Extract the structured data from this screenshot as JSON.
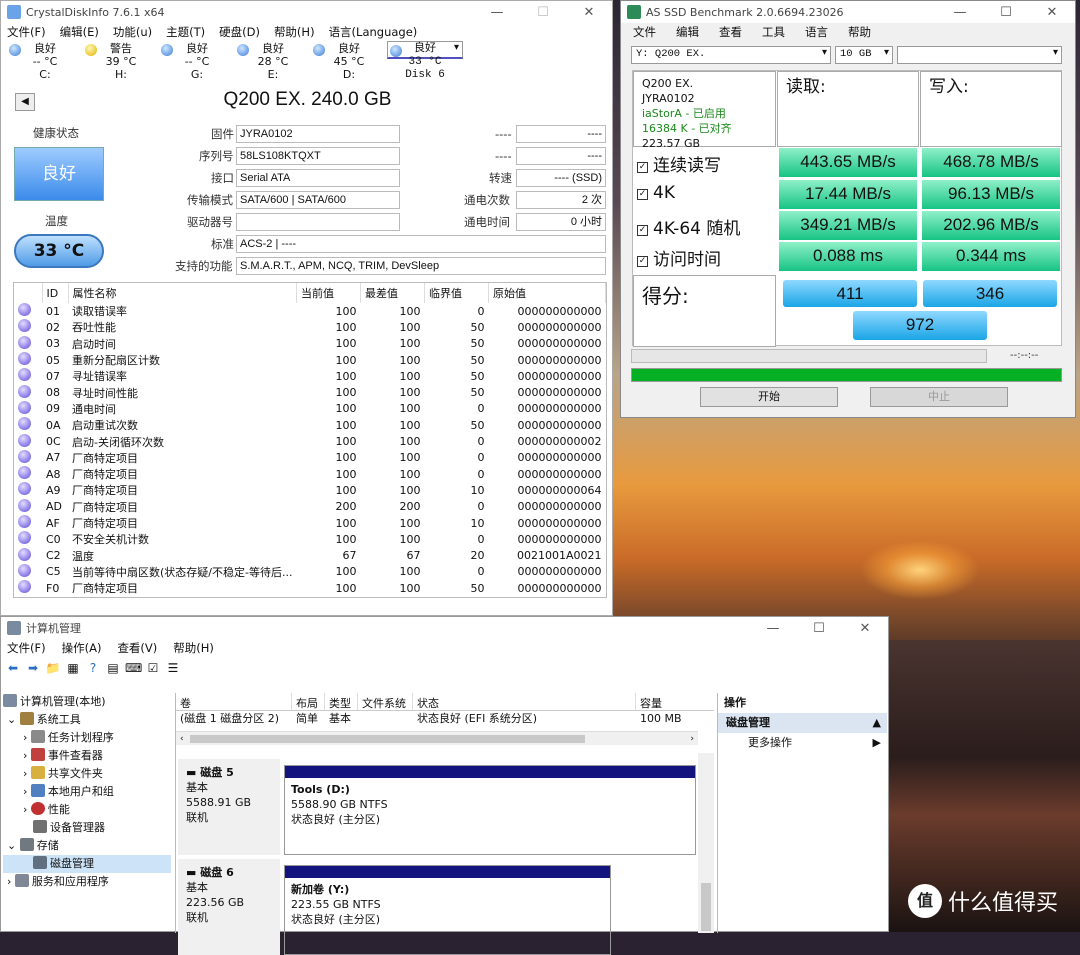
{
  "cdi": {
    "title": "CrystalDiskInfo 7.6.1 x64",
    "menu": [
      "文件(F)",
      "编辑(E)",
      "功能(u)",
      "主题(T)",
      "硬盘(D)",
      "帮助(H)",
      "语言(Language)"
    ],
    "drives": [
      {
        "status": "良好",
        "temp": "-- °C",
        "letter": "C:"
      },
      {
        "status": "警告",
        "temp": "39 °C",
        "letter": "H:"
      },
      {
        "status": "良好",
        "temp": "-- °C",
        "letter": "G:"
      },
      {
        "status": "良好",
        "temp": "28 °C",
        "letter": "E:"
      },
      {
        "status": "良好",
        "temp": "45 °C",
        "letter": "D:"
      },
      {
        "status": "良好",
        "temp": "33 °C",
        "letter": "Disk 6"
      }
    ],
    "model": "Q200 EX. 240.0 GB",
    "health_label": "健康状态",
    "health": "良好",
    "temp_label": "温度",
    "temp": "33 °C",
    "firmware_l": "固件",
    "firmware": "JYRA0102",
    "serial_l": "序列号",
    "serial": "58LS108KTQXT",
    "iface_l": "接口",
    "iface": "Serial ATA",
    "mode_l": "传输模式",
    "mode": "SATA/600 | SATA/600",
    "letter_l": "驱动器号",
    "letter": "",
    "std_l": "标准",
    "std": "ACS-2 | ----",
    "feat_l": "支持的功能",
    "feat": "S.M.A.R.T., APM, NCQ, TRIM, DevSleep",
    "r1a": "----",
    "r1b": "----",
    "r2a": "----",
    "r2b": "----",
    "rot_l": "转速",
    "rot": "---- (SSD)",
    "pc_l": "通电次数",
    "pc": "2 次",
    "ph_l": "通电时间",
    "ph": "0 小时",
    "smart_head": [
      "ID",
      "属性名称",
      "当前值",
      "最差值",
      "临界值",
      "原始值"
    ],
    "smart": [
      [
        "01",
        "读取错误率",
        "100",
        "100",
        "0",
        "000000000000"
      ],
      [
        "02",
        "吞吐性能",
        "100",
        "100",
        "50",
        "000000000000"
      ],
      [
        "03",
        "启动时间",
        "100",
        "100",
        "50",
        "000000000000"
      ],
      [
        "05",
        "重新分配扇区计数",
        "100",
        "100",
        "50",
        "000000000000"
      ],
      [
        "07",
        "寻址错误率",
        "100",
        "100",
        "50",
        "000000000000"
      ],
      [
        "08",
        "寻址时间性能",
        "100",
        "100",
        "50",
        "000000000000"
      ],
      [
        "09",
        "通电时间",
        "100",
        "100",
        "0",
        "000000000000"
      ],
      [
        "0A",
        "启动重试次数",
        "100",
        "100",
        "50",
        "000000000000"
      ],
      [
        "0C",
        "启动-关闭循环次数",
        "100",
        "100",
        "0",
        "000000000002"
      ],
      [
        "A7",
        "厂商特定项目",
        "100",
        "100",
        "0",
        "000000000000"
      ],
      [
        "A8",
        "厂商特定项目",
        "100",
        "100",
        "0",
        "000000000000"
      ],
      [
        "A9",
        "厂商特定项目",
        "100",
        "100",
        "10",
        "000000000064"
      ],
      [
        "AD",
        "厂商特定项目",
        "200",
        "200",
        "0",
        "000000000000"
      ],
      [
        "AF",
        "厂商特定项目",
        "100",
        "100",
        "10",
        "000000000000"
      ],
      [
        "C0",
        "不安全关机计数",
        "100",
        "100",
        "0",
        "000000000000"
      ],
      [
        "C2",
        "温度",
        "67",
        "67",
        "20",
        "0021001A0021"
      ],
      [
        "C5",
        "当前等待中扇区数(状态存疑/不稳定-等待后...",
        "100",
        "100",
        "0",
        "000000000000"
      ],
      [
        "F0",
        "厂商特定项目",
        "100",
        "100",
        "50",
        "000000000000"
      ]
    ]
  },
  "ssd": {
    "title": "AS SSD Benchmark 2.0.6694.23026",
    "menu": [
      "文件",
      "编辑",
      "查看",
      "工具",
      "语言",
      "帮助"
    ],
    "drive": "Y: Q200 EX.",
    "size": "10 GB",
    "info": [
      "Q200 EX.",
      "JYRA0102",
      "iaStorA - 已启用",
      "16384 K - 已对齐",
      "223.57 GB"
    ],
    "read_h": "读取:",
    "write_h": "写入:",
    "rows": [
      {
        "label": "连续读写",
        "read": "443.65 MB/s",
        "write": "468.78 MB/s"
      },
      {
        "label": "4K",
        "read": "17.44 MB/s",
        "write": "96.13 MB/s"
      },
      {
        "label": "4K-64 随机",
        "read": "349.21 MB/s",
        "write": "202.96 MB/s"
      },
      {
        "label": "访问时间",
        "read": "0.088 ms",
        "write": "0.344 ms"
      }
    ],
    "score_l": "得分:",
    "score_r": "411",
    "score_w": "346",
    "score_t": "972",
    "time": "--:--:--",
    "progress": 1.0,
    "start": "开始",
    "stop": "中止"
  },
  "cm": {
    "title": "计算机管理",
    "menu": [
      "文件(F)",
      "操作(A)",
      "查看(V)",
      "帮助(H)"
    ],
    "tree": [
      "计算机管理(本地)",
      "系统工具",
      "任务计划程序",
      "事件查看器",
      "共享文件夹",
      "本地用户和组",
      "性能",
      "设备管理器",
      "存储",
      "磁盘管理",
      "服务和应用程序"
    ],
    "cols": [
      "卷",
      "布局",
      "类型",
      "文件系统",
      "状态",
      "容量"
    ],
    "row": [
      "(磁盘 1 磁盘分区 2)",
      "简单",
      "基本",
      "",
      "状态良好 (EFI 系统分区)",
      "100 MB"
    ],
    "disk5": {
      "name": "磁盘 5",
      "type": "基本",
      "size": "5588.91 GB",
      "state": "联机",
      "vol": "Tools (D:)",
      "vsize": "5588.90 GB NTFS",
      "vstate": "状态良好 (主分区)"
    },
    "disk6": {
      "name": "磁盘 6",
      "type": "基本",
      "size": "223.56 GB",
      "state": "联机",
      "vol": "新加卷 (Y:)",
      "vsize": "223.55 GB NTFS",
      "vstate": "状态良好 (主分区)"
    },
    "act_h": "操作",
    "act_s": "磁盘管理",
    "act_m": "更多操作"
  },
  "wm": {
    "logo": "值",
    "text": "什么值得买"
  }
}
